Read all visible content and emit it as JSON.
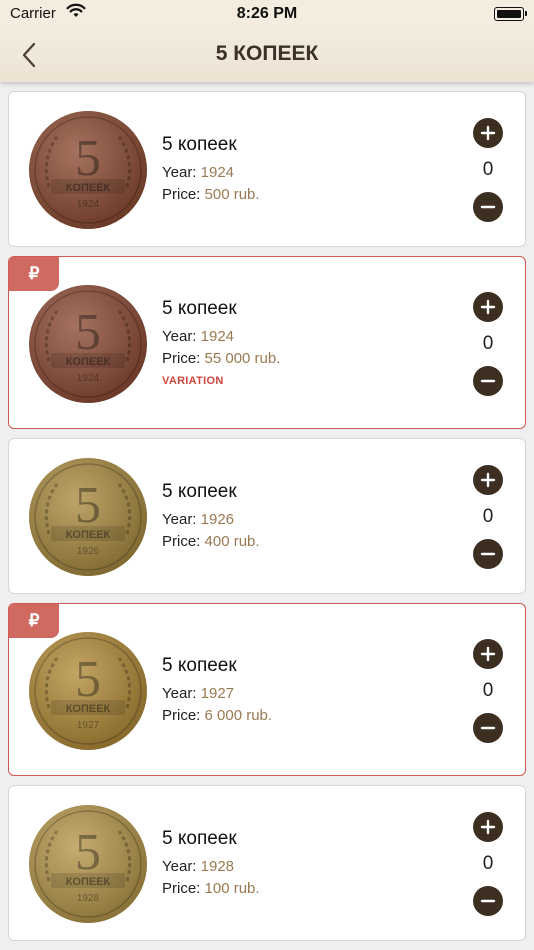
{
  "status": {
    "carrier": "Carrier",
    "time": "8:26 PM"
  },
  "header": {
    "title": "5 КОПЕЕК"
  },
  "labels": {
    "year": "Year:",
    "price": "Price:"
  },
  "accent": "#3d2e22",
  "variation_color": "#d0463d",
  "items": [
    {
      "name": "5 копеек",
      "year": "1924",
      "price": "500 rub.",
      "count": "0",
      "badge": "",
      "variation": "",
      "coin_color": "#8a4a30",
      "coin_year": "1924"
    },
    {
      "name": "5 копеек",
      "year": "1924",
      "price": "55 000 rub.",
      "count": "0",
      "badge": "₽",
      "variation": "VARIATION",
      "coin_color": "#8b4a33",
      "coin_year": "1924"
    },
    {
      "name": "5 копеек",
      "year": "1926",
      "price": "400 rub.",
      "count": "0",
      "badge": "",
      "variation": "",
      "coin_color": "#a8893e",
      "coin_year": "1926"
    },
    {
      "name": "5 копеек",
      "year": "1927",
      "price": "6 000 rub.",
      "count": "0",
      "badge": "₽",
      "variation": "",
      "coin_color": "#b08a36",
      "coin_year": "1927"
    },
    {
      "name": "5 копеек",
      "year": "1928",
      "price": "100 rub.",
      "count": "0",
      "badge": "",
      "variation": "",
      "coin_color": "#b49548",
      "coin_year": "1928"
    }
  ]
}
